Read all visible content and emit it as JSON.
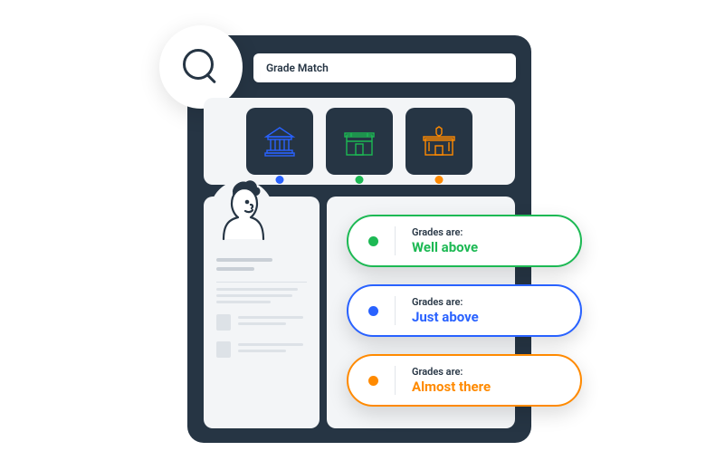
{
  "search": {
    "value": "Grade Match"
  },
  "tiles": [
    {
      "name": "institution-tile",
      "icon": "columns-building",
      "dot": "blue"
    },
    {
      "name": "school-tile",
      "icon": "school-building",
      "dot": "green"
    },
    {
      "name": "civic-tile",
      "icon": "civic-building",
      "dot": "orange"
    }
  ],
  "grades_label": "Grades are:",
  "results": [
    {
      "value": "Well above",
      "color": "green"
    },
    {
      "value": "Just above",
      "color": "blue"
    },
    {
      "value": "Almost there",
      "color": "orange"
    }
  ]
}
